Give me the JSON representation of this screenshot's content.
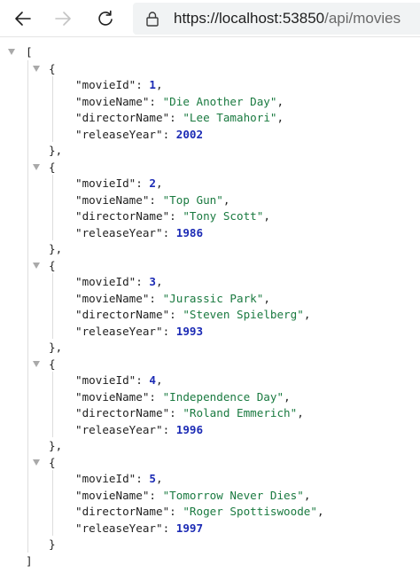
{
  "browser": {
    "url_host": "https://localhost:53850",
    "url_path": "/api/movies",
    "icons": {
      "back": "back-arrow-icon",
      "forward": "forward-arrow-icon",
      "refresh": "refresh-icon",
      "lock": "lock-icon"
    }
  },
  "json": {
    "open_bracket": "[",
    "close_bracket": "]",
    "open_brace": "{",
    "close_brace_comma": "},",
    "close_brace": "}",
    "keys": {
      "movieId": "\"movieId\"",
      "movieName": "\"movieName\"",
      "directorName": "\"directorName\"",
      "releaseYear": "\"releaseYear\""
    },
    "movies": [
      {
        "movieId": "1",
        "movieName": "\"Die Another Day\"",
        "directorName": "\"Lee Tamahori\"",
        "releaseYear": "2002"
      },
      {
        "movieId": "2",
        "movieName": "\"Top Gun\"",
        "directorName": "\"Tony Scott\"",
        "releaseYear": "1986"
      },
      {
        "movieId": "3",
        "movieName": "\"Jurassic Park\"",
        "directorName": "\"Steven Spielberg\"",
        "releaseYear": "1993"
      },
      {
        "movieId": "4",
        "movieName": "\"Independence Day\"",
        "directorName": "\"Roland Emmerich\"",
        "releaseYear": "1996"
      },
      {
        "movieId": "5",
        "movieName": "\"Tomorrow Never Dies\"",
        "directorName": "\"Roger Spottiswoode\"",
        "releaseYear": "1997"
      }
    ]
  }
}
